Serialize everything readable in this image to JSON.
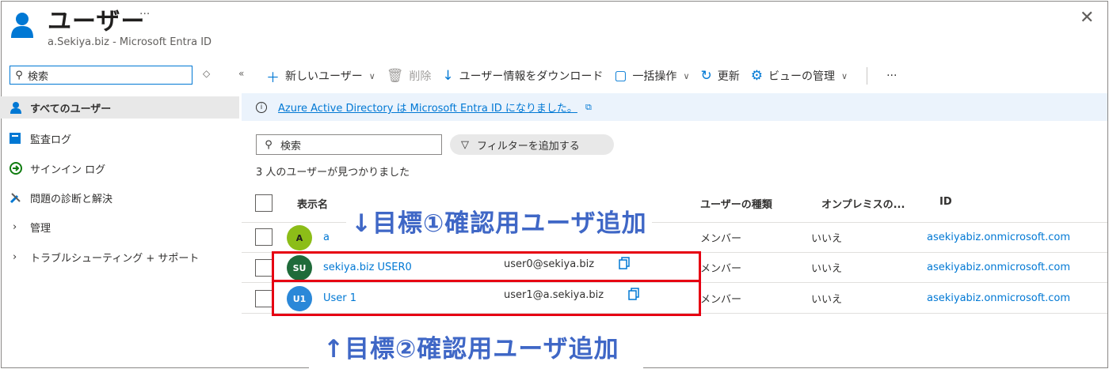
{
  "header": {
    "title": "ユーザー",
    "more": "···",
    "subtitle": "a.Sekiya.biz - Microsoft Entra ID",
    "close": "✕"
  },
  "sidebar": {
    "search_value": "検索",
    "collapse_icons": "◇ «",
    "items": [
      {
        "label": "すべてのユーザー",
        "icon": "user-icon",
        "active": true
      },
      {
        "label": "監査ログ",
        "icon": "audit-log-icon"
      },
      {
        "label": "サインイン ログ",
        "icon": "sign-in-icon"
      },
      {
        "label": "問題の診断と解決",
        "icon": "wrench-icon"
      },
      {
        "label": "管理",
        "icon": "chevron-right-icon"
      },
      {
        "label": "トラブルシューティング + サポート",
        "icon": "chevron-right-icon"
      }
    ]
  },
  "toolbar": {
    "new_user": "新しいユーザー",
    "delete": "削除",
    "download": "ユーザー情報をダウンロード",
    "bulk": "一括操作",
    "refresh": "更新",
    "manage_view": "ビューの管理",
    "more": "···"
  },
  "banner": {
    "text": "Azure Active Directory は Microsoft Entra ID になりました。"
  },
  "filters": {
    "search_placeholder": "検索",
    "add_filter": "フィルターを追加する"
  },
  "result_count": "3 人のユーザーが見つかりました",
  "table": {
    "columns": [
      "表示名",
      "ユーザーの種類",
      "オンプレミスの...",
      "ID"
    ],
    "rows": [
      {
        "initials": "A",
        "avatar_color": "#8cbd18",
        "name": "a",
        "upn": "",
        "type": "メンバー",
        "onprem": "いいえ",
        "id": "asekiyabiz.onmicrosoft.com"
      },
      {
        "initials": "SU",
        "avatar_color": "#1f6b3a",
        "name": "sekiya.biz USER0",
        "upn": "user0@sekiya.biz",
        "type": "メンバー",
        "onprem": "いいえ",
        "id": "asekiyabiz.onmicrosoft.com"
      },
      {
        "initials": "U1",
        "avatar_color": "#2b88d8",
        "name": "User 1",
        "upn": "user1@a.sekiya.biz",
        "type": "メンバー",
        "onprem": "いいえ",
        "id": "asekiyabiz.onmicrosoft.com"
      }
    ]
  },
  "annotations": {
    "goal1": "↓目標①確認用ユーザ追加",
    "goal2": "↑目標②確認用ユーザ追加"
  },
  "colors": {
    "accent": "#0078d4",
    "annotation_text": "#3f67c6",
    "annotation_box": "#e60012"
  }
}
